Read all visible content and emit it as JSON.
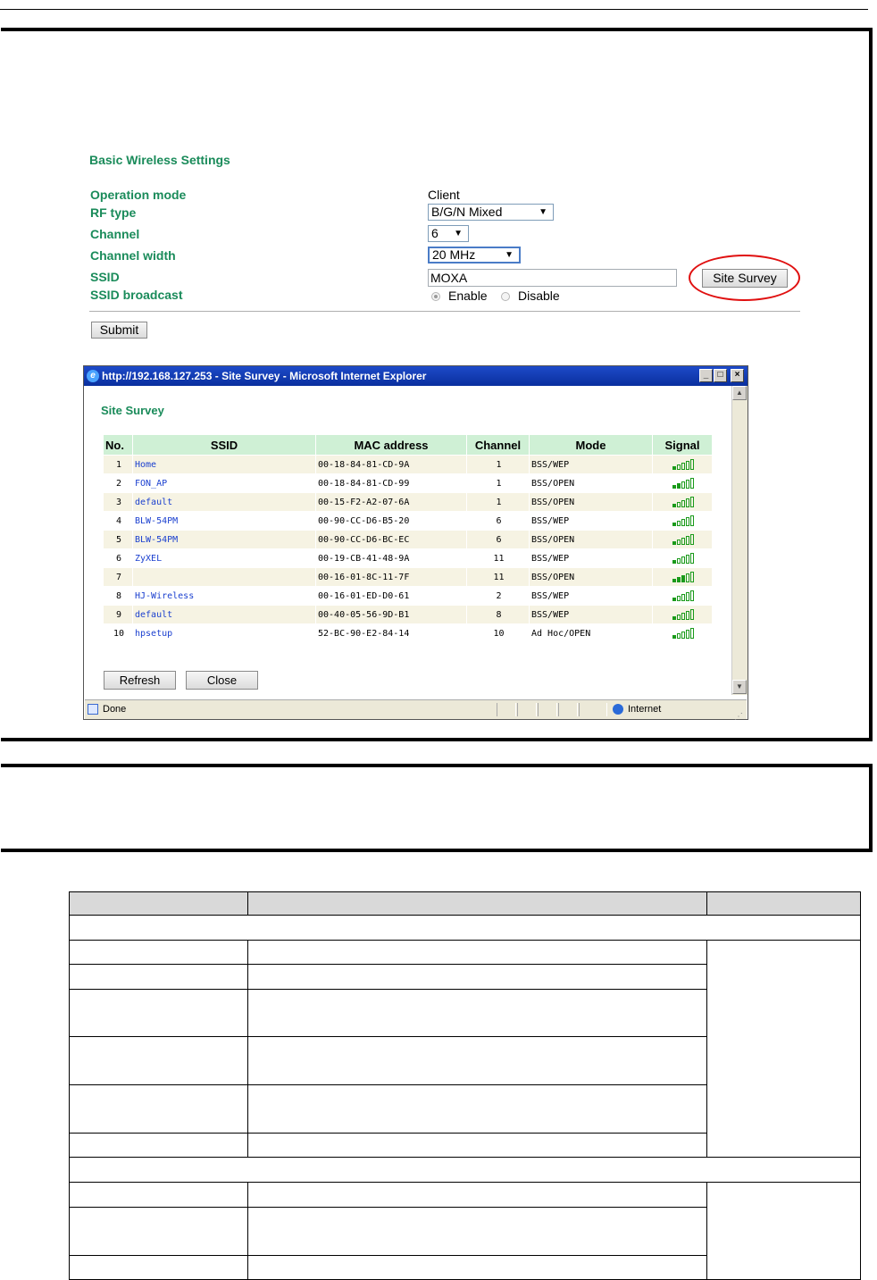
{
  "settings": {
    "title": "Basic Wireless Settings",
    "operation_mode_label": "Operation mode",
    "operation_mode_value": "Client",
    "rf_type_label": "RF type",
    "rf_type_value": "B/G/N Mixed",
    "channel_label": "Channel",
    "channel_value": "6",
    "channel_width_label": "Channel width",
    "channel_width_value": "20 MHz",
    "ssid_label": "SSID",
    "ssid_value": "MOXA",
    "site_survey_button": "Site Survey",
    "ssid_broadcast_label": "SSID broadcast",
    "enable_label": "Enable",
    "disable_label": "Disable",
    "ssid_broadcast_selected": "Enable",
    "submit_button": "Submit"
  },
  "popup": {
    "window_title": "http://192.168.127.253 - Site Survey - Microsoft Internet Explorer",
    "heading": "Site Survey",
    "columns": [
      "No.",
      "SSID",
      "MAC address",
      "Channel",
      "Mode",
      "Signal"
    ],
    "rows": [
      {
        "no": "1",
        "ssid": "Home",
        "mac": "00-18-84-81-CD-9A",
        "channel": "1",
        "mode": "BSS/WEP",
        "signal": 1
      },
      {
        "no": "2",
        "ssid": "FON_AP",
        "mac": "00-18-84-81-CD-99",
        "channel": "1",
        "mode": "BSS/OPEN",
        "signal": 2
      },
      {
        "no": "3",
        "ssid": "default",
        "mac": "00-15-F2-A2-07-6A",
        "channel": "1",
        "mode": "BSS/OPEN",
        "signal": 1
      },
      {
        "no": "4",
        "ssid": "BLW-54PM",
        "mac": "00-90-CC-D6-B5-20",
        "channel": "6",
        "mode": "BSS/WEP",
        "signal": 1
      },
      {
        "no": "5",
        "ssid": "BLW-54PM",
        "mac": "00-90-CC-D6-BC-EC",
        "channel": "6",
        "mode": "BSS/OPEN",
        "signal": 1
      },
      {
        "no": "6",
        "ssid": "ZyXEL",
        "mac": "00-19-CB-41-48-9A",
        "channel": "11",
        "mode": "BSS/WEP",
        "signal": 1
      },
      {
        "no": "7",
        "ssid": "",
        "mac": "00-16-01-8C-11-7F",
        "channel": "11",
        "mode": "BSS/OPEN",
        "signal": 3
      },
      {
        "no": "8",
        "ssid": "HJ-Wireless",
        "mac": "00-16-01-ED-D0-61",
        "channel": "2",
        "mode": "BSS/WEP",
        "signal": 1
      },
      {
        "no": "9",
        "ssid": "default",
        "mac": "00-40-05-56-9D-B1",
        "channel": "8",
        "mode": "BSS/WEP",
        "signal": 1
      },
      {
        "no": "10",
        "ssid": "hpsetup",
        "mac": "52-BC-90-E2-84-14",
        "channel": "10",
        "mode": "Ad Hoc/OPEN",
        "signal": 1
      }
    ],
    "refresh_button": "Refresh",
    "close_button": "Close",
    "status_text": "Done",
    "zone_text": "Internet"
  },
  "colors": {
    "label_green": "#1a8b5a",
    "header_bg": "#cff0d5",
    "link_blue": "#1a3fcf",
    "signal_green": "#1a9a1a",
    "highlight_red": "#e01010"
  }
}
